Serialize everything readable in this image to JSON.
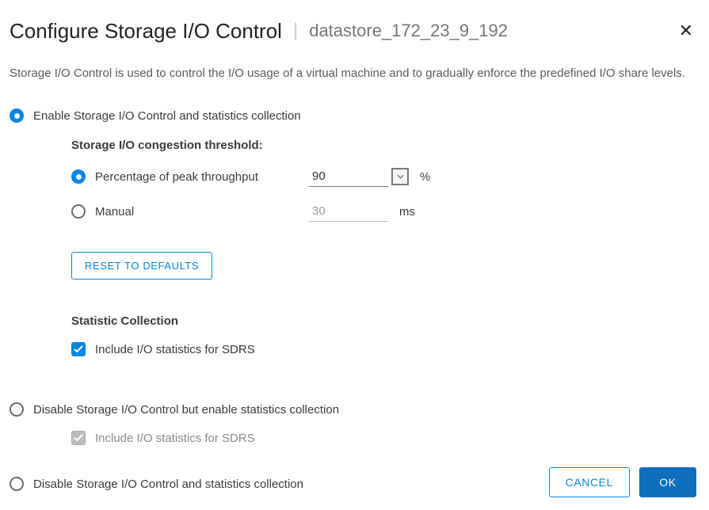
{
  "header": {
    "title": "Configure Storage I/O Control",
    "subtitle": "datastore_172_23_9_192"
  },
  "description": "Storage I/O Control is used to control the I/O usage of a virtual machine and to gradually enforce the predefined I/O share levels.",
  "options": {
    "enable": {
      "label": "Enable Storage I/O Control and statistics collection",
      "selected": true
    },
    "disable_with_stats": {
      "label": "Disable Storage I/O Control but enable statistics collection",
      "selected": false
    },
    "disable_all": {
      "label": "Disable Storage I/O Control and statistics collection",
      "selected": false
    }
  },
  "threshold": {
    "title": "Storage I/O congestion threshold:",
    "percentage": {
      "label": "Percentage of peak throughput",
      "value": "90",
      "unit": "%",
      "selected": true
    },
    "manual": {
      "label": "Manual",
      "value": "30",
      "unit": "ms",
      "selected": false
    },
    "reset_label": "RESET TO DEFAULTS"
  },
  "stats": {
    "title": "Statistic Collection",
    "include_sdrs": {
      "label": "Include I/O statistics for SDRS",
      "checked": true
    },
    "include_sdrs_disabled": {
      "label": "Include I/O statistics for SDRS",
      "checked": true
    }
  },
  "footer": {
    "cancel": "CANCEL",
    "ok": "OK"
  }
}
